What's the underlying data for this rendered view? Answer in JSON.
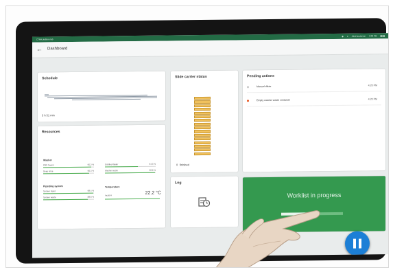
{
  "statusbar": {
    "app_name": "CTRA platform lab",
    "user": "AlexHenderson",
    "time": "9:00 PM"
  },
  "appbar": {
    "back_icon": "back-arrow-icon",
    "title": "Dashboard"
  },
  "schedule": {
    "title": "Schedule",
    "time_left": "3 h 51 min"
  },
  "resources": {
    "title": "Resources",
    "washer": {
      "title": "Washer",
      "items": [
        {
          "label": "PBS Tween",
          "value": "95.2 %",
          "level": 0.95
        },
        {
          "label": "Deep rinse",
          "value": "90.3 %",
          "level": 0.9
        },
        {
          "label": "Distilled Water",
          "value": "64.5 %",
          "level": 0.65
        },
        {
          "label": "Washer waste",
          "value": "98.6 %",
          "level": 0.98
        }
      ]
    },
    "pipetting": {
      "title": "Pipetting system",
      "items": [
        {
          "label": "System liquid",
          "value": "98.4 %",
          "level": 0.98
        },
        {
          "label": "System waste",
          "value": "88.8 %",
          "level": 0.88
        }
      ]
    },
    "temperature": {
      "title": "Temperature",
      "item_label": "Incub A",
      "value": "22.2 °C"
    }
  },
  "slide_carrier": {
    "title": "Slide carrier status",
    "finished_count": "0",
    "finished_label": "finished",
    "slots": 16
  },
  "log": {
    "title": "Log",
    "icon": "log-clock-icon"
  },
  "pending": {
    "title": "Pending actions",
    "items": [
      {
        "text": "Manual dilute",
        "time": "4:20 PM",
        "status_color": "#c9c9c9"
      },
      {
        "text": "Empty washer waste container",
        "time": "4:20 PM",
        "status_color": "#e8541e"
      }
    ]
  },
  "worklist": {
    "title": "Worklist in progress",
    "progress": 0.5
  },
  "pause_button": {
    "icon": "pause-icon"
  },
  "colors": {
    "accent_green": "#34994f",
    "statusbar_green": "#236b45",
    "pause_blue": "#1c7fd6"
  }
}
